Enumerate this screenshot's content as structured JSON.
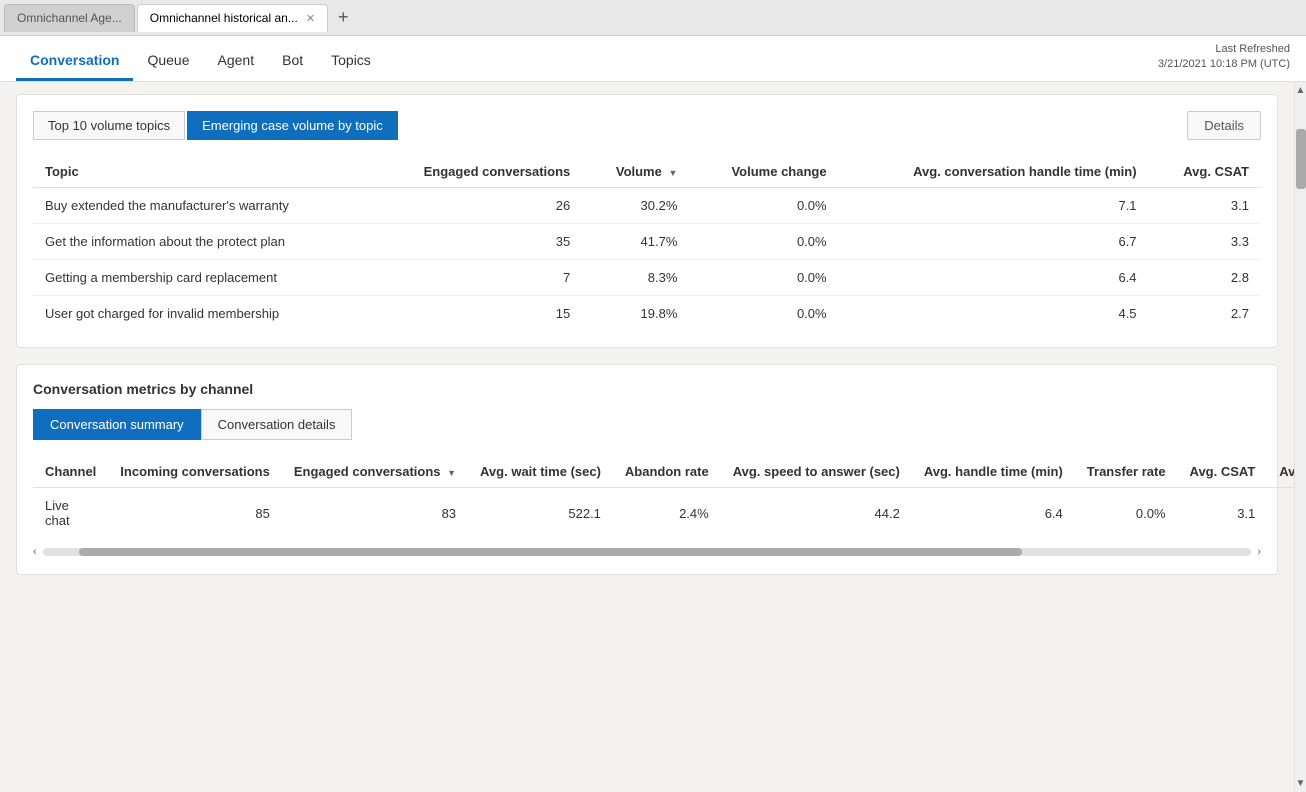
{
  "browser": {
    "tabs": [
      {
        "id": "tab1",
        "label": "Omnichannel Age...",
        "active": false,
        "closable": false
      },
      {
        "id": "tab2",
        "label": "Omnichannel historical an...",
        "active": true,
        "closable": true
      }
    ],
    "add_tab_label": "+"
  },
  "nav": {
    "items": [
      {
        "id": "conversation",
        "label": "Conversation",
        "active": true
      },
      {
        "id": "queue",
        "label": "Queue",
        "active": false
      },
      {
        "id": "agent",
        "label": "Agent",
        "active": false
      },
      {
        "id": "bot",
        "label": "Bot",
        "active": false
      },
      {
        "id": "topics",
        "label": "Topics",
        "active": false
      }
    ],
    "last_refreshed_label": "Last Refreshed",
    "last_refreshed_value": "3/21/2021 10:18 PM (UTC)"
  },
  "topics_panel": {
    "tab_top10": "Top 10 volume topics",
    "tab_emerging": "Emerging case volume by topic",
    "details_btn": "Details",
    "table": {
      "columns": [
        {
          "id": "topic",
          "label": "Topic",
          "align": "left"
        },
        {
          "id": "engaged",
          "label": "Engaged conversations",
          "align": "right"
        },
        {
          "id": "volume",
          "label": "Volume",
          "align": "right",
          "sortable": true
        },
        {
          "id": "volume_change",
          "label": "Volume change",
          "align": "right"
        },
        {
          "id": "avg_handle",
          "label": "Avg. conversation handle time (min)",
          "align": "right"
        },
        {
          "id": "avg_csat",
          "label": "Avg. CSAT",
          "align": "right"
        }
      ],
      "rows": [
        {
          "topic": "Buy extended the manufacturer's warranty",
          "engaged": "26",
          "volume": "30.2%",
          "volume_change": "0.0%",
          "avg_handle": "7.1",
          "avg_csat": "3.1"
        },
        {
          "topic": "Get the information about the protect plan",
          "engaged": "35",
          "volume": "41.7%",
          "volume_change": "0.0%",
          "avg_handle": "6.7",
          "avg_csat": "3.3"
        },
        {
          "topic": "Getting a membership card replacement",
          "engaged": "7",
          "volume": "8.3%",
          "volume_change": "0.0%",
          "avg_handle": "6.4",
          "avg_csat": "2.8"
        },
        {
          "topic": "User got charged for invalid membership",
          "engaged": "15",
          "volume": "19.8%",
          "volume_change": "0.0%",
          "avg_handle": "4.5",
          "avg_csat": "2.7"
        }
      ]
    }
  },
  "metrics_panel": {
    "section_title": "Conversation metrics by channel",
    "sub_tab_summary": "Conversation summary",
    "sub_tab_details": "Conversation details",
    "table": {
      "columns": [
        {
          "id": "channel",
          "label": "Channel",
          "align": "left"
        },
        {
          "id": "incoming",
          "label": "Incoming conversations",
          "align": "right"
        },
        {
          "id": "engaged",
          "label": "Engaged conversations",
          "align": "right",
          "sortable": true
        },
        {
          "id": "avg_wait",
          "label": "Avg. wait time (sec)",
          "align": "right"
        },
        {
          "id": "abandon_rate",
          "label": "Abandon rate",
          "align": "right"
        },
        {
          "id": "avg_speed",
          "label": "Avg. speed to answer (sec)",
          "align": "right"
        },
        {
          "id": "avg_handle",
          "label": "Avg. handle time (min)",
          "align": "right"
        },
        {
          "id": "transfer_rate",
          "label": "Transfer rate",
          "align": "right"
        },
        {
          "id": "avg_csat",
          "label": "Avg. CSAT",
          "align": "right"
        },
        {
          "id": "avg_survey",
          "label": "Avg. survey se",
          "align": "right"
        }
      ],
      "rows": [
        {
          "channel": "Live chat",
          "incoming": "85",
          "engaged": "83",
          "avg_wait": "522.1",
          "abandon_rate": "2.4%",
          "avg_speed": "44.2",
          "avg_handle": "6.4",
          "transfer_rate": "0.0%",
          "avg_csat": "3.1",
          "avg_survey": ""
        }
      ]
    }
  },
  "colors": {
    "active_tab_bg": "#106ebe",
    "active_nav_color": "#106ebe"
  }
}
